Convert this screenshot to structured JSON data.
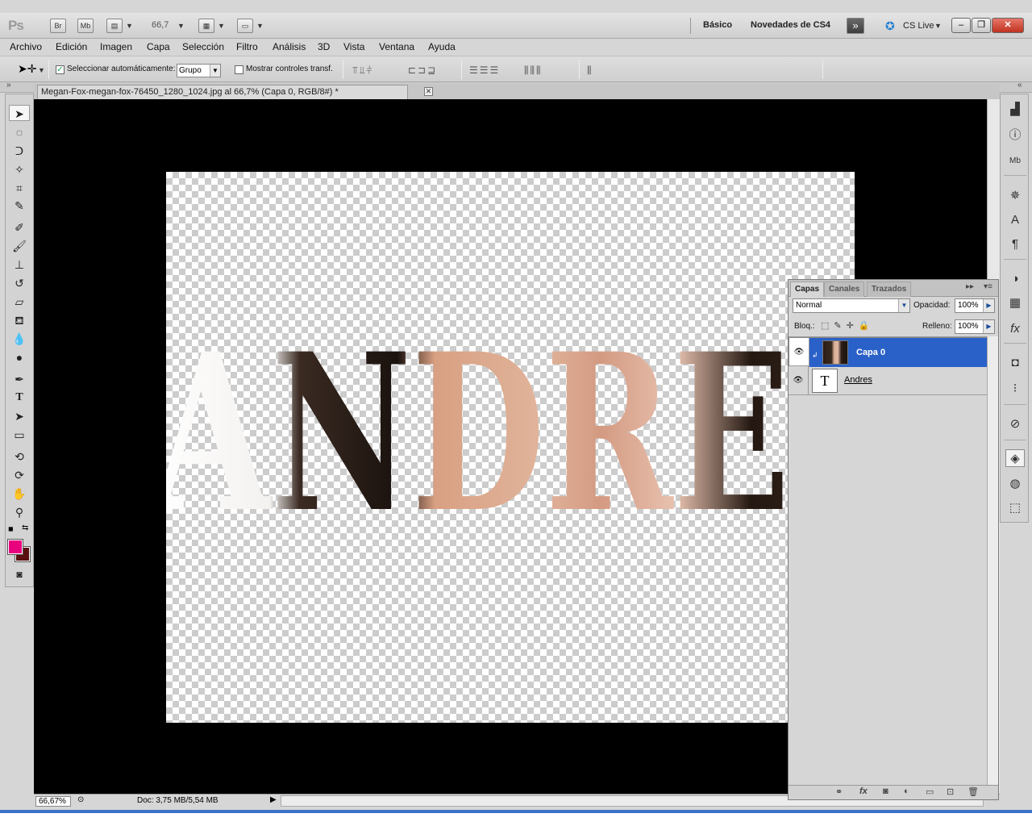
{
  "app": {
    "logo": "Ps",
    "bridge_btn": "Br",
    "minibridge_btn": "Mb",
    "zoom": "66,7",
    "workspaces": [
      "Básico",
      "Novedades de CS4"
    ],
    "cs_live": "CS Live"
  },
  "menu": [
    "Archivo",
    "Edición",
    "Imagen",
    "Capa",
    "Selección",
    "Filtro",
    "Análisis",
    "3D",
    "Vista",
    "Ventana",
    "Ayuda"
  ],
  "options": {
    "auto_select_label": "Seleccionar automáticamente:",
    "auto_select_value": "Grupo",
    "show_transform_label": "Mostrar controles transf."
  },
  "document": {
    "tab_title": "Megan-Fox-megan-fox-76450_1280_1024.jpg al 66,7% (Capa 0, RGB/8#) *",
    "text": "ANDRES"
  },
  "status": {
    "zoom": "66,67%",
    "doc_size": "Doc: 3,75 MB/5,54 MB"
  },
  "layers_panel": {
    "tabs": [
      "Capas",
      "Canales",
      "Trazados"
    ],
    "blend_mode": "Normal",
    "opacity_label": "Opacidad:",
    "opacity_value": "100%",
    "lock_label": "Bloq.:",
    "fill_label": "Relleno:",
    "fill_value": "100%",
    "layers": [
      {
        "name": "Capa 0",
        "selected": true
      },
      {
        "name": "Andres",
        "selected": false
      }
    ]
  },
  "colors": {
    "foreground": "#e8007d",
    "background": "#5a1010",
    "selection": "#2a61c8"
  }
}
